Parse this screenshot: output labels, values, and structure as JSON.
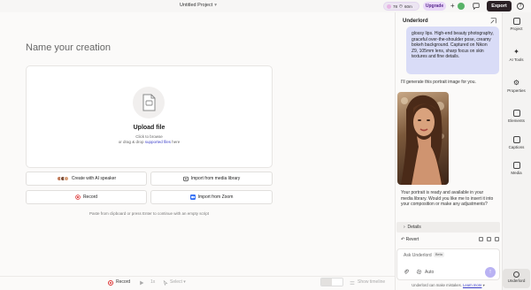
{
  "header": {
    "project_title": "Untitled Project",
    "credits_a": "78",
    "credits_b": "60m",
    "upgrade_label": "Upgrade",
    "plus_label": "+",
    "export_label": "Export",
    "help_label": "?"
  },
  "main": {
    "heading": "Name your creation",
    "upload_title": "Upload file",
    "upload_sub1": "Click to browse",
    "upload_sub2_prefix": "or drag & drop ",
    "upload_sub2_link": "supported files",
    "upload_sub2_suffix": " here",
    "buttons": {
      "ai_speaker": "Create with AI speaker",
      "media_library": "Import from media library",
      "record": "Record",
      "zoom": "Import from Zoom"
    },
    "paste_hint": "Paste from clipboard or press Enter to continue with an empty script"
  },
  "bottombar": {
    "record_label": "Record",
    "speed": "1x",
    "select_label": "Select",
    "show_timeline": "Show timeline"
  },
  "assistant": {
    "title": "Underlord",
    "prompt_text": "glossy lips. High-end beauty photography, graceful over-the-shoulder pose, creamy bokeh background. Captured on Nikon Z9, 105mm lens, sharp focus on skin textures and fine details.",
    "reply_text": "I'll generate this portrait image for you.",
    "status_text": "Your portrait is ready and available in your media library. Would you like me to insert it into your composition or make any adjustments?",
    "details_label": "Details",
    "revert_label": "Revert",
    "input_placeholder": "Ask Underlord",
    "beta_label": "Beta",
    "mode_label": "Auto",
    "disclaimer_prefix": "Underlord can make mistakes. ",
    "disclaimer_link": "Learn more"
  },
  "rail": {
    "items": [
      {
        "label": "Project"
      },
      {
        "label": "AI Tools"
      },
      {
        "label": "Properties"
      },
      {
        "label": "Elements"
      },
      {
        "label": "Captions"
      },
      {
        "label": "Media"
      },
      {
        "label": "Underlord"
      }
    ]
  },
  "colors": {
    "accent": "#3c3fc9",
    "prompt_bubble": "#d9dcf7",
    "export_bg": "#2a2025",
    "upgrade_bg": "#e9d7f8",
    "record_red": "#dd3333"
  }
}
